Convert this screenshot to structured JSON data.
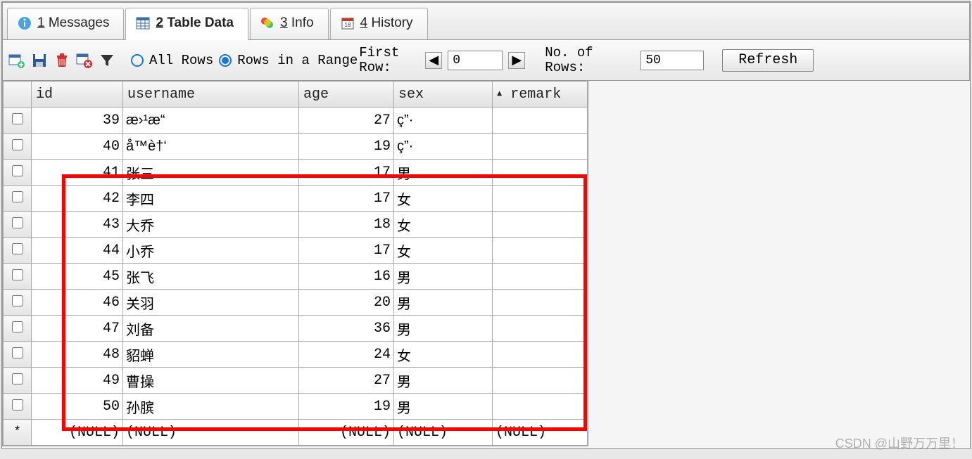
{
  "tabs": [
    {
      "num": "1",
      "label": "Messages"
    },
    {
      "num": "2",
      "label": "Table Data"
    },
    {
      "num": "3",
      "label": "Info"
    },
    {
      "num": "4",
      "label": "History"
    }
  ],
  "toolbar": {
    "allRows": "All Rows",
    "rowsRange": "Rows in a Range",
    "firstRow": "First Row:",
    "firstRowVal": "0",
    "noRows": "No. of Rows:",
    "noRowsVal": "50",
    "refresh": "Refresh"
  },
  "columns": {
    "id": "id",
    "username": "username",
    "age": "age",
    "sex": "sex",
    "remark": "remark"
  },
  "rows": [
    {
      "id": "39",
      "username": "æ›¹æ“",
      "age": "27",
      "sex": "ç”·",
      "remark": ""
    },
    {
      "id": "40",
      "username": "å­™è†‘",
      "age": "19",
      "sex": "ç”·",
      "remark": ""
    },
    {
      "id": "41",
      "username": "张三",
      "age": "17",
      "sex": "男",
      "remark": ""
    },
    {
      "id": "42",
      "username": "李四",
      "age": "17",
      "sex": "女",
      "remark": ""
    },
    {
      "id": "43",
      "username": "大乔",
      "age": "18",
      "sex": "女",
      "remark": ""
    },
    {
      "id": "44",
      "username": "小乔",
      "age": "17",
      "sex": "女",
      "remark": ""
    },
    {
      "id": "45",
      "username": "张飞",
      "age": "16",
      "sex": "男",
      "remark": ""
    },
    {
      "id": "46",
      "username": "关羽",
      "age": "20",
      "sex": "男",
      "remark": ""
    },
    {
      "id": "47",
      "username": "刘备",
      "age": "36",
      "sex": "男",
      "remark": ""
    },
    {
      "id": "48",
      "username": "貂蝉",
      "age": "24",
      "sex": "女",
      "remark": ""
    },
    {
      "id": "49",
      "username": "曹操",
      "age": "27",
      "sex": "男",
      "remark": ""
    },
    {
      "id": "50",
      "username": "孙膑",
      "age": "19",
      "sex": "男",
      "remark": ""
    }
  ],
  "nullRow": {
    "id": "(NULL)",
    "username": "(NULL)",
    "age": "(NULL)",
    "sex": "(NULL)",
    "remark": "(NULL)"
  },
  "watermark": "CSDN @山野万万里！"
}
